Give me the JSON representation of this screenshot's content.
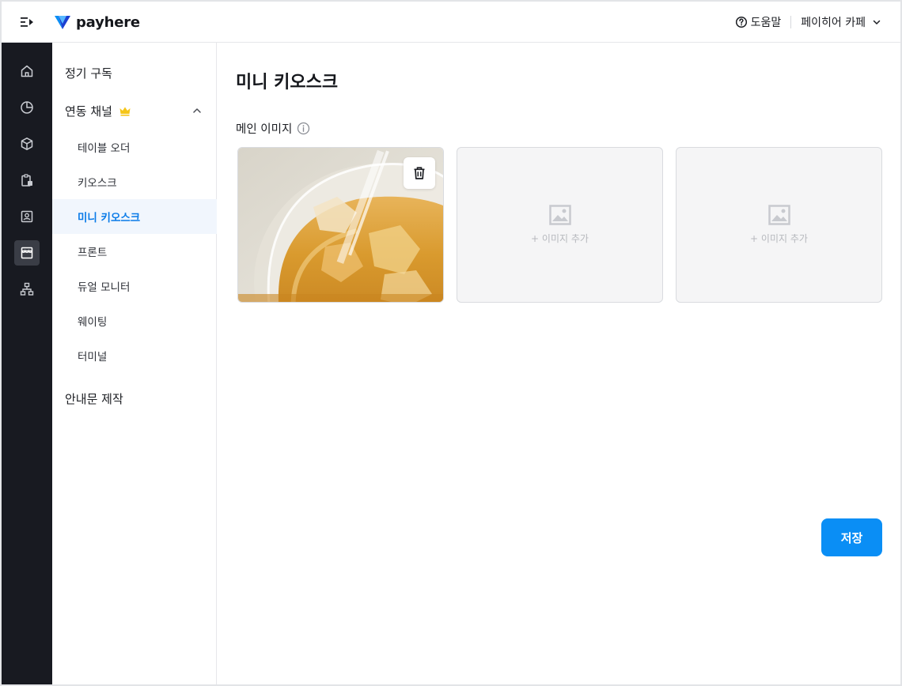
{
  "header": {
    "logo_text": "payhere",
    "help_label": "도움말",
    "store_name": "페이히어 카페"
  },
  "rail": {
    "items": [
      {
        "icon": "home-icon"
      },
      {
        "icon": "pie-chart-icon"
      },
      {
        "icon": "box-icon"
      },
      {
        "icon": "clipboard-icon"
      },
      {
        "icon": "contact-card-icon"
      },
      {
        "icon": "storefront-icon",
        "active": true
      },
      {
        "icon": "org-chart-icon"
      }
    ]
  },
  "subnav": {
    "subscription": "정기 구독",
    "linked_channels": "연동 채널",
    "items": [
      "테이블 오더",
      "키오스크",
      "미니 키오스크",
      "프론트",
      "듀얼 모니터",
      "웨이팅",
      "터미널"
    ],
    "notice": "안내문 제작",
    "active_item": "미니 키오스크"
  },
  "main": {
    "title": "미니 키오스크",
    "section_label": "메인 이미지",
    "add_image_label": "+ 이미지 추가",
    "save_label": "저장"
  },
  "colors": {
    "accent": "#0a8ef5",
    "active_text": "#0a7be8",
    "rail_bg": "#181a21",
    "crown": "#f5c518"
  }
}
